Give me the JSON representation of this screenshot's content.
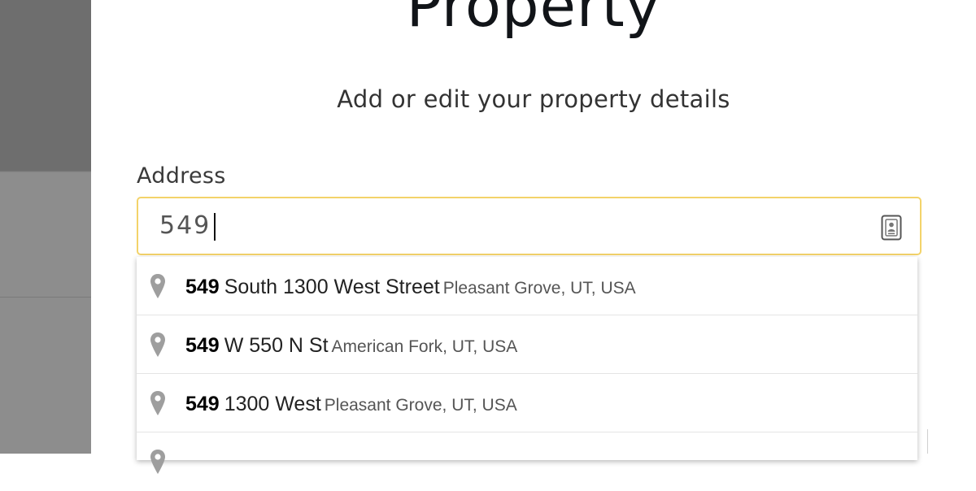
{
  "modal": {
    "title": "Property",
    "subtitle": "Add or edit your property details"
  },
  "address_field": {
    "label": "Address",
    "value": "549",
    "trailing_icon": "contact-card-icon",
    "focus_color": "#f3d36a"
  },
  "suggestions": [
    {
      "match": "549",
      "street": "South 1300 West Street",
      "locality": "Pleasant Grove, UT, USA",
      "icon": "map-pin-icon"
    },
    {
      "match": "549",
      "street": "W 550 N St",
      "locality": "American Fork, UT, USA",
      "icon": "map-pin-icon"
    },
    {
      "match": "549",
      "street": "1300 West",
      "locality": "Pleasant Grove, UT, USA",
      "icon": "map-pin-icon"
    }
  ],
  "colors": {
    "backdrop": "#6e6e6e",
    "pin": "#9e9e9e"
  }
}
